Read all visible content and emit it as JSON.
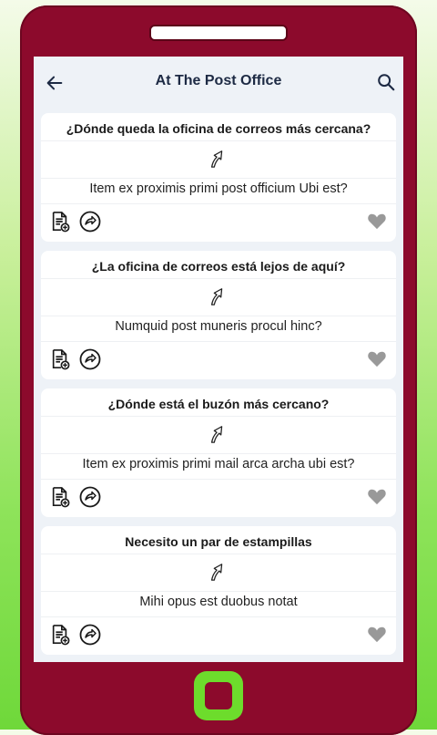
{
  "header": {
    "title": "At The Post Office"
  },
  "cards": [
    {
      "question": "¿Dónde queda la oficina de correos más cercana?",
      "answer": "Item ex proximis primi post officium Ubi est?"
    },
    {
      "question": "¿La oficina de correos está lejos de aquí?",
      "answer": "Numquid post muneris procul hinc?"
    },
    {
      "question": "¿Dónde está el buzón más cercano?",
      "answer": "Item ex proximis primi mail arca archa ubi est?"
    },
    {
      "question": "Necesito un par de estampillas",
      "answer": "Mihi opus est duobus notat"
    }
  ],
  "colors": {
    "phone": "#8c0a2c",
    "homeButton": "#6ddc2c",
    "title": "#1d2a44",
    "icon": "#1a1a1a",
    "heart": "#999999"
  },
  "icons": [
    "back-arrow-icon",
    "search-icon",
    "curved-arrow-icon",
    "add-document-icon",
    "share-icon",
    "heart-icon"
  ]
}
